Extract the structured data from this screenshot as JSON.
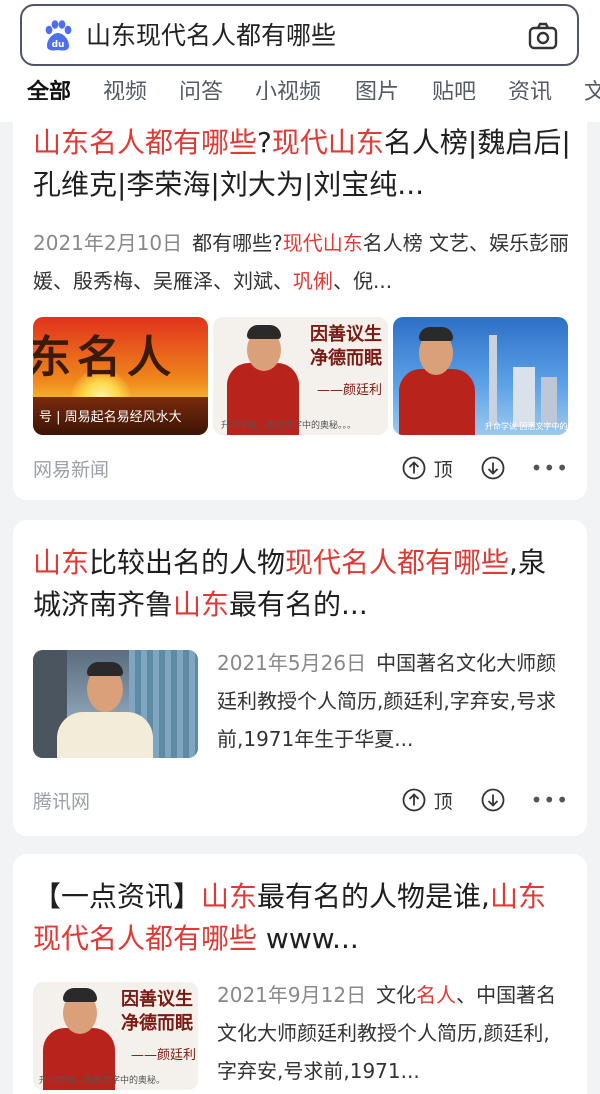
{
  "search": {
    "query": "山东现代名人都有哪些"
  },
  "tabs": [
    "全部",
    "视频",
    "问答",
    "小视频",
    "图片",
    "贴吧",
    "资讯",
    "文"
  ],
  "results": [
    {
      "title_parts": [
        {
          "t": "山东名人都有哪些",
          "hl": true
        },
        {
          "t": "?",
          "hl": false
        },
        {
          "t": "现代山东",
          "hl": true
        },
        {
          "t": "名人榜|魏启后|孔维克|李荣海|刘大为|刘宝纯...",
          "hl": false
        }
      ],
      "date": "2021年2月10日",
      "snippet_parts": [
        {
          "t": "都有哪些?",
          "hl": false
        },
        {
          "t": "现代山东",
          "hl": true
        },
        {
          "t": "名人榜 文艺、娱乐彭丽媛、殷秀梅、吴雁泽、刘斌、",
          "hl": false
        },
        {
          "t": "巩俐",
          "hl": true
        },
        {
          "t": "、倪...",
          "hl": false
        }
      ],
      "images": [
        {
          "text": "东名人",
          "caption": "号 | 周易起名易经风水大"
        },
        {
          "text": "因善议生 净德而眠",
          "sign": "——颜廷利",
          "caption": "升命学说—因悉文字中的奥秘。。。"
        },
        {
          "text": "",
          "caption": "升命学说·因悉文字中的奥秘"
        }
      ],
      "source": "网易新闻",
      "vote_label": "顶"
    },
    {
      "title_parts": [
        {
          "t": "山东",
          "hl": true
        },
        {
          "t": "比较出名的人物",
          "hl": false
        },
        {
          "t": "现代名人都有哪些",
          "hl": true
        },
        {
          "t": ",泉城济南齐鲁",
          "hl": false
        },
        {
          "t": "山东",
          "hl": true
        },
        {
          "t": "最有名的...",
          "hl": false
        }
      ],
      "date": "2021年5月26日",
      "snippet": "中国著名文化大师颜廷利教授个人简历,颜廷利,字弃安,号求前,1971年生于华夏...",
      "source": "腾讯网",
      "vote_label": "顶"
    },
    {
      "title_parts": [
        {
          "t": "【一点资讯】",
          "hl": false
        },
        {
          "t": "山东",
          "hl": true
        },
        {
          "t": "最有名的人物是谁,",
          "hl": false
        },
        {
          "t": "山东现代名人都有哪些",
          "hl": true
        },
        {
          "t": " www...",
          "hl": false
        }
      ],
      "date": "2021年9月12日",
      "snippet_parts": [
        {
          "t": "文化",
          "hl": false
        },
        {
          "t": "名人",
          "hl": true
        },
        {
          "t": "、中国著名文化大师颜廷利教授个人简历,颜廷利,字弃安,号求前,1971...",
          "hl": false
        }
      ],
      "image": {
        "text": "因善议生 净德而眠",
        "sign": "——颜廷利",
        "caption": "升命学说—因悉文字中的奥秘。"
      }
    }
  ],
  "colors": {
    "highlight": "#e03a35",
    "accent": "#4e6ef2"
  }
}
